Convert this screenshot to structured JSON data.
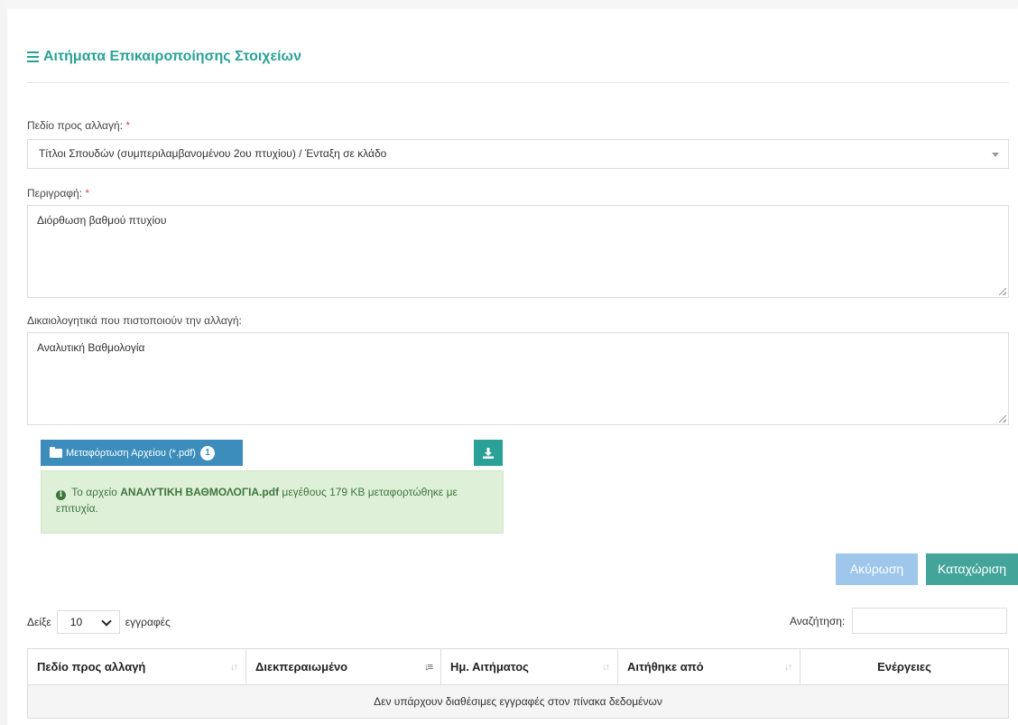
{
  "page": {
    "title": "Αιτήματα Επικαιροποίησης Στοιχείων",
    "accent_color": "#2aa197"
  },
  "form": {
    "field_label": "Πεδίο προς αλλαγή:",
    "required_mark": "*",
    "field_value": "Τίτλοι Σπουδών (συμπεριλαμβανομένου 2ου πτυχίου) / Ένταξη σε κλάδο",
    "description_label": "Περιγραφή:",
    "description_value": "Διόρθωση βαθμού πτυχίου",
    "documents_label": "Δικαιολογητικά που πιστοποιούν την αλλαγή:",
    "documents_value": "Αναλυτική Βαθμολογία",
    "upload_label": "Μεταφόρτωση Αρχείου (*.pdf)",
    "upload_count": "1",
    "alert_prefix": "Το αρχείο",
    "alert_filename": "ΑΝΑΛΥΤΙΚΗ ΒΑΘΜΟΛΟΓΙΑ.pdf",
    "alert_suffix": "μεγέθους 179 KB μεταφορτώθηκε με επιτυχία.",
    "cancel_label": "Ακύρωση",
    "submit_label": "Καταχώριση"
  },
  "table_controls": {
    "show_label": "Δείξε",
    "page_length": "10",
    "entries_label": "εγγραφές",
    "search_label": "Αναζήτηση:"
  },
  "table": {
    "columns": [
      "Πεδίο προς αλλαγή",
      "Διεκπεραιωμένο",
      "Ημ. Αιτήματος",
      "Αιτήθηκε από",
      "Ενέργειες"
    ],
    "empty_message": "Δεν υπάρχουν διαθέσιμες εγγραφές στον πίνακα δεδομένων"
  }
}
